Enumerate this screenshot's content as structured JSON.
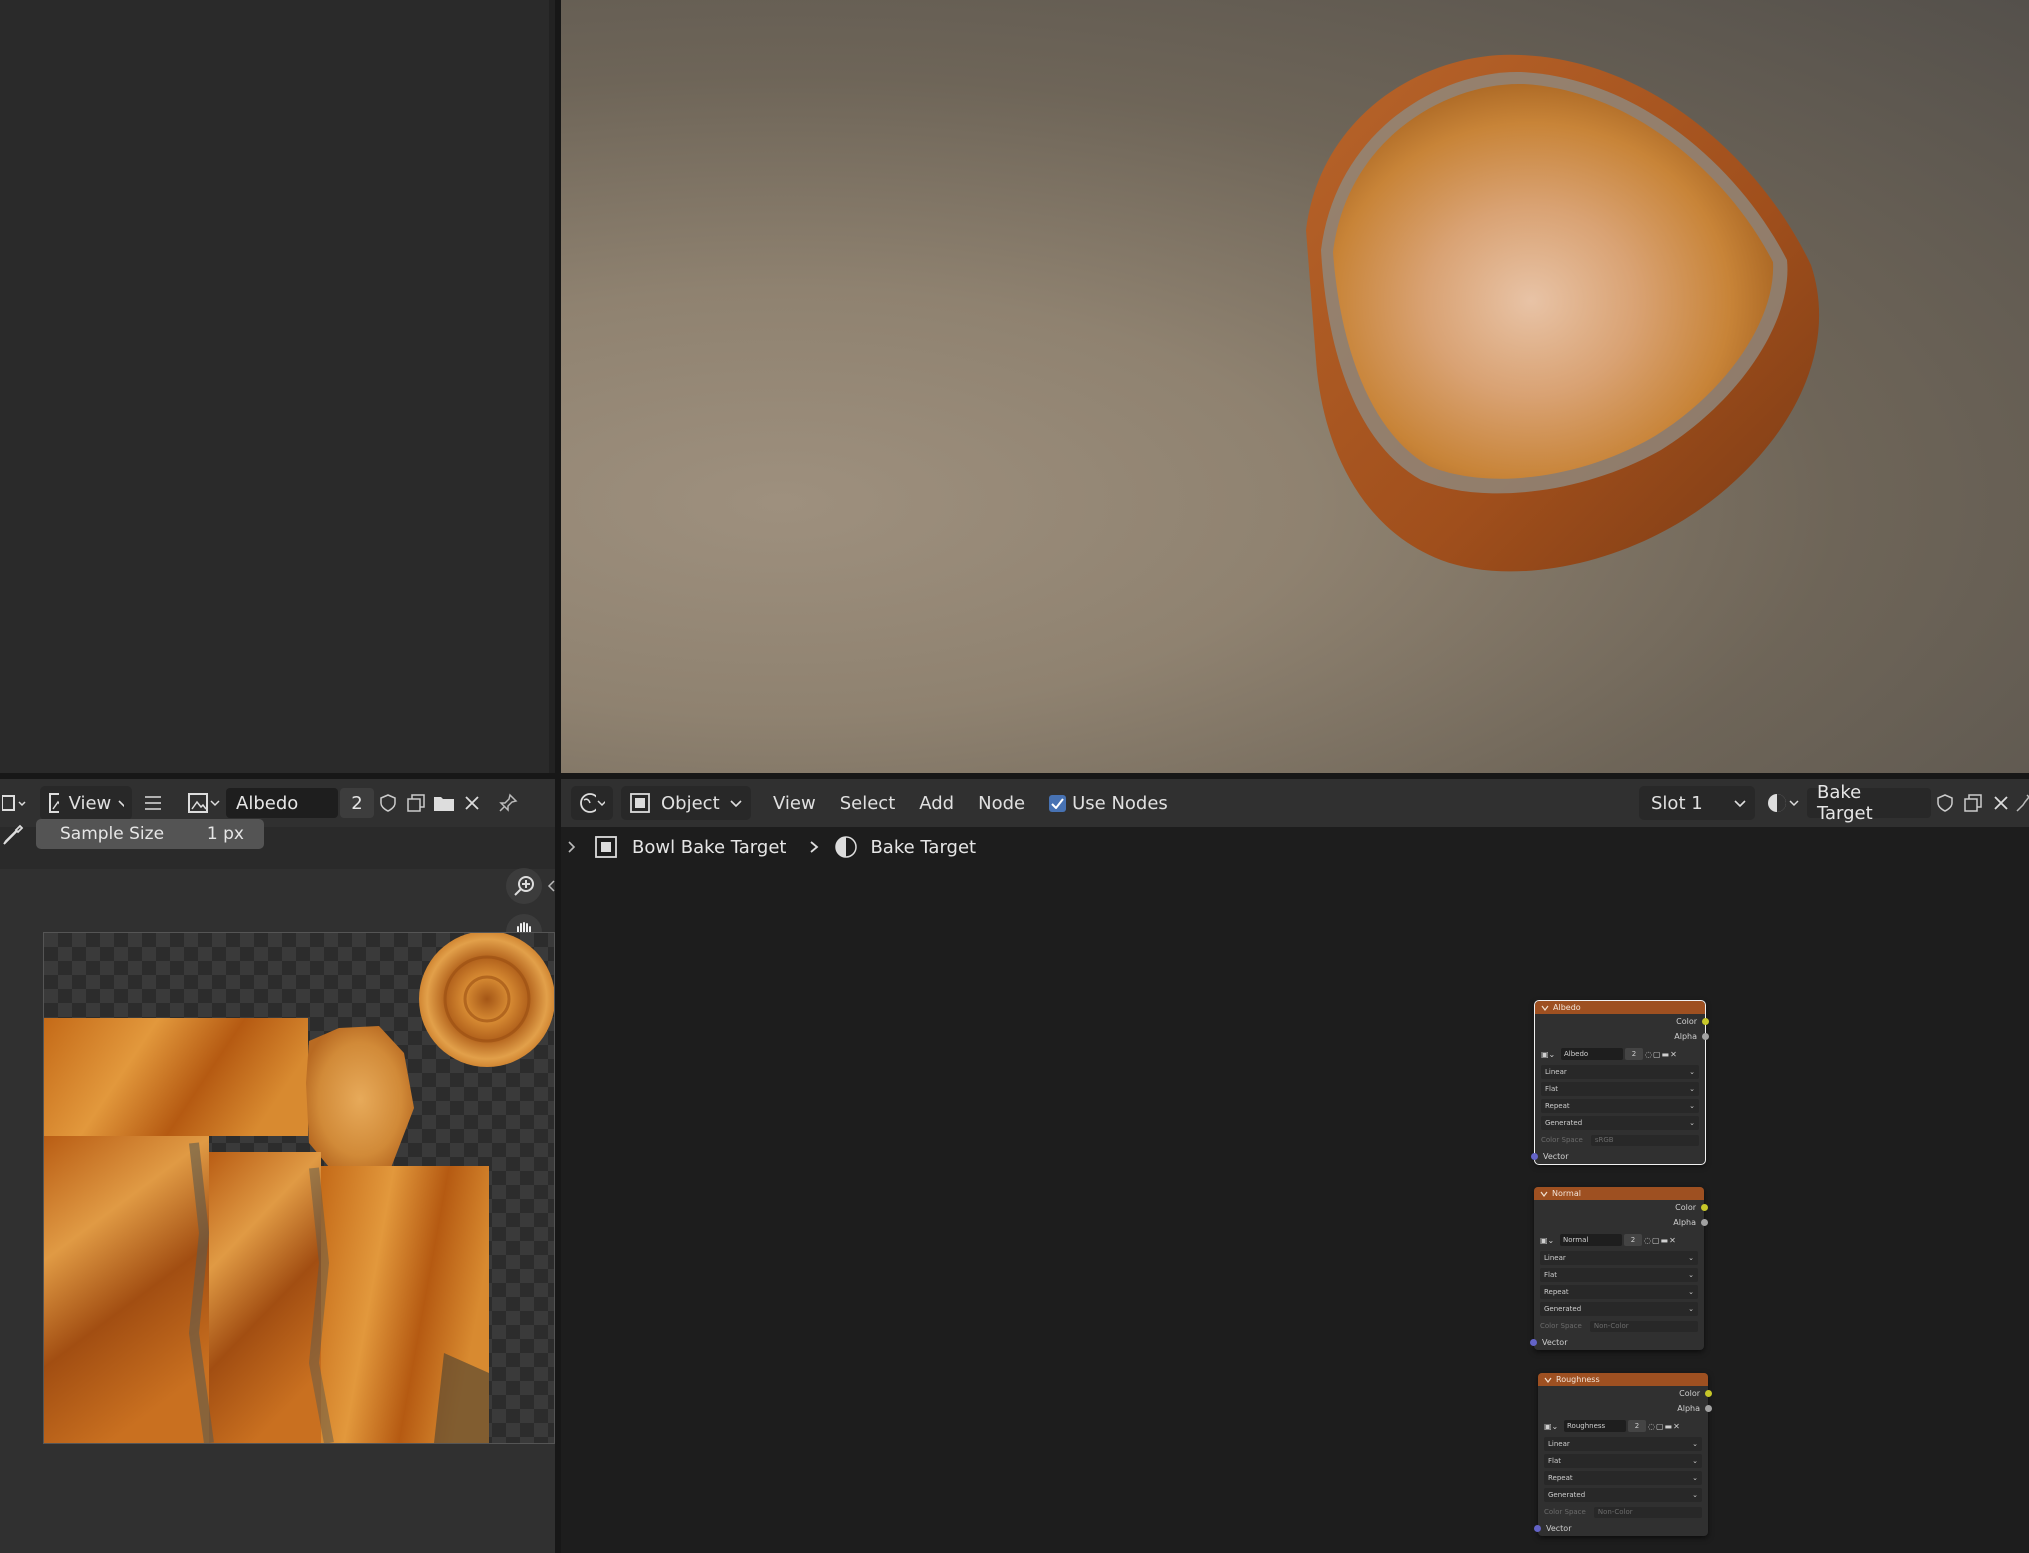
{
  "image_editor": {
    "view_label": "View",
    "image_name": "Albedo",
    "users_count": "2",
    "sample_size_label": "Sample Size",
    "sample_size_value": "1 px"
  },
  "node_editor": {
    "object_mode": "Object",
    "menus": [
      "View",
      "Select",
      "Add",
      "Node"
    ],
    "use_nodes_label": "Use Nodes",
    "slot": "Slot 1",
    "material_name": "Bake Target",
    "breadcrumb": {
      "object": "Bowl Bake Target",
      "material": "Bake Target"
    }
  },
  "nodes": [
    {
      "title": "Albedo",
      "image": "Albedo",
      "users": "2",
      "interpolation": "Linear",
      "projection": "Flat",
      "extension": "Repeat",
      "source": "Generated",
      "color_space_label": "Color Space",
      "color_space": "sRGB",
      "out_color": "Color",
      "out_alpha": "Alpha",
      "in_vector": "Vector"
    },
    {
      "title": "Normal",
      "image": "Normal",
      "users": "2",
      "interpolation": "Linear",
      "projection": "Flat",
      "extension": "Repeat",
      "source": "Generated",
      "color_space_label": "Color Space",
      "color_space": "Non-Color",
      "out_color": "Color",
      "out_alpha": "Alpha",
      "in_vector": "Vector"
    },
    {
      "title": "Roughness",
      "image": "Roughness",
      "users": "2",
      "interpolation": "Linear",
      "projection": "Flat",
      "extension": "Repeat",
      "source": "Generated",
      "color_space_label": "Color Space",
      "color_space": "Non-Color",
      "out_color": "Color",
      "out_alpha": "Alpha",
      "in_vector": "Vector"
    }
  ],
  "colors": {
    "node_header": "#9e5021",
    "socket_color": "#c7c729",
    "socket_alpha": "#a1a1a1",
    "socket_vector": "#6363c7",
    "accent": "#4772b3"
  }
}
